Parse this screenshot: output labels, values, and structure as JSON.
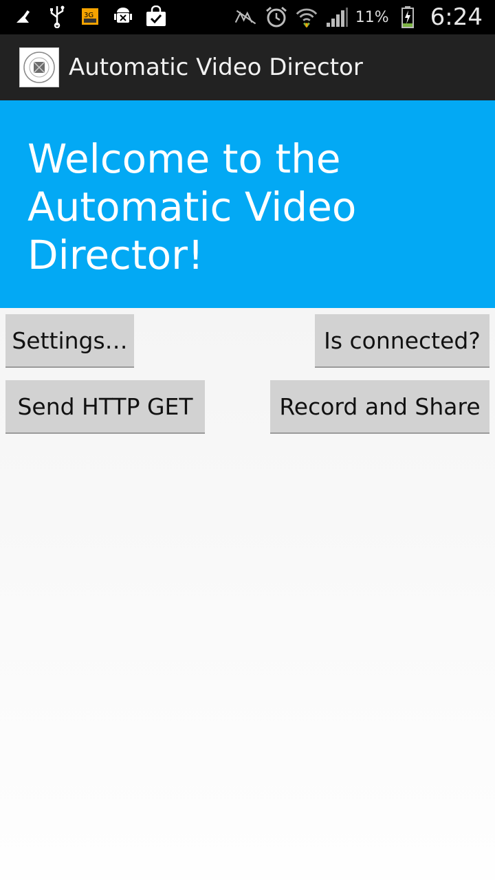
{
  "status_bar": {
    "icons_left": [
      "cleaner-icon",
      "usb-icon",
      "3g-icon",
      "android-debug-icon",
      "shopping-bag-icon"
    ],
    "icons_right": [
      "nfc-icon",
      "alarm-icon",
      "wifi-icon",
      "signal-icon",
      "battery-charging-icon"
    ],
    "battery_percent": "11%",
    "time": "6:24",
    "network_badge": "3G"
  },
  "action_bar": {
    "title": "Automatic Video Director"
  },
  "banner": {
    "text": "Welcome to the Automatic Video Director!",
    "color": "#03a9f4"
  },
  "buttons": {
    "settings": "Settings…",
    "is_connected": "Is connected?",
    "send_http_get": "Send HTTP GET",
    "record_and_share": "Record and Share"
  }
}
